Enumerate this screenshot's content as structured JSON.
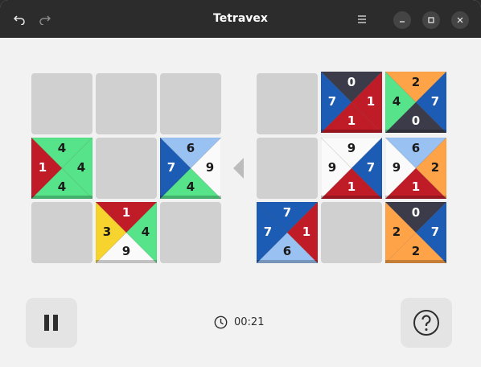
{
  "window": {
    "title": "Tetravex"
  },
  "colors": {
    "0": "#3b3b4a",
    "1": "#c01c28",
    "2": "#ffa348",
    "3": "#f6d32d",
    "4": "#57e389",
    "6": "#99c1f1",
    "7": "#1c5cb4",
    "9": "#fafafa"
  },
  "boards": {
    "left": [
      [
        null,
        null,
        null
      ],
      [
        {
          "t": 4,
          "r": 4,
          "b": 4,
          "l": 1
        },
        null,
        {
          "t": 6,
          "r": 9,
          "b": 4,
          "l": 7
        }
      ],
      [
        null,
        {
          "t": 1,
          "r": 4,
          "b": 9,
          "l": 3
        },
        null
      ]
    ],
    "right": [
      [
        null,
        {
          "t": 0,
          "r": 1,
          "b": 1,
          "l": 7
        },
        {
          "t": 2,
          "r": 7,
          "b": 0,
          "l": 4
        }
      ],
      [
        null,
        {
          "t": 9,
          "r": 7,
          "b": 1,
          "l": 9
        },
        {
          "t": 6,
          "r": 2,
          "b": 1,
          "l": 9
        }
      ],
      [
        {
          "t": 7,
          "r": 1,
          "b": 6,
          "l": 7
        },
        null,
        {
          "t": 0,
          "r": 7,
          "b": 2,
          "l": 2
        }
      ]
    ]
  },
  "timer": {
    "elapsed": "00:21"
  }
}
